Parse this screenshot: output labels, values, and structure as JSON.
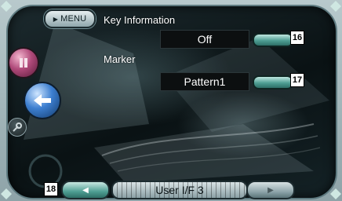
{
  "top_menu": {
    "label": "MENU"
  },
  "items": [
    {
      "label": "Key Information",
      "value": "Off",
      "badge": "16"
    },
    {
      "label": "Marker",
      "value": "Pattern1",
      "badge": "17"
    }
  ],
  "bottom": {
    "badge": "18",
    "page_title": "User I/F 3"
  },
  "icons": {
    "menu_triangle": "play-icon",
    "pause": "pause-icon",
    "back": "return-arrow-icon",
    "tool": "wrench-icon",
    "prev": "left-arrow-icon",
    "next": "right-arrow-icon"
  },
  "colors": {
    "accent_teal": "#4e9e93",
    "value_box_bg": "#0c0f10",
    "screen_bg": "#0a1214"
  }
}
